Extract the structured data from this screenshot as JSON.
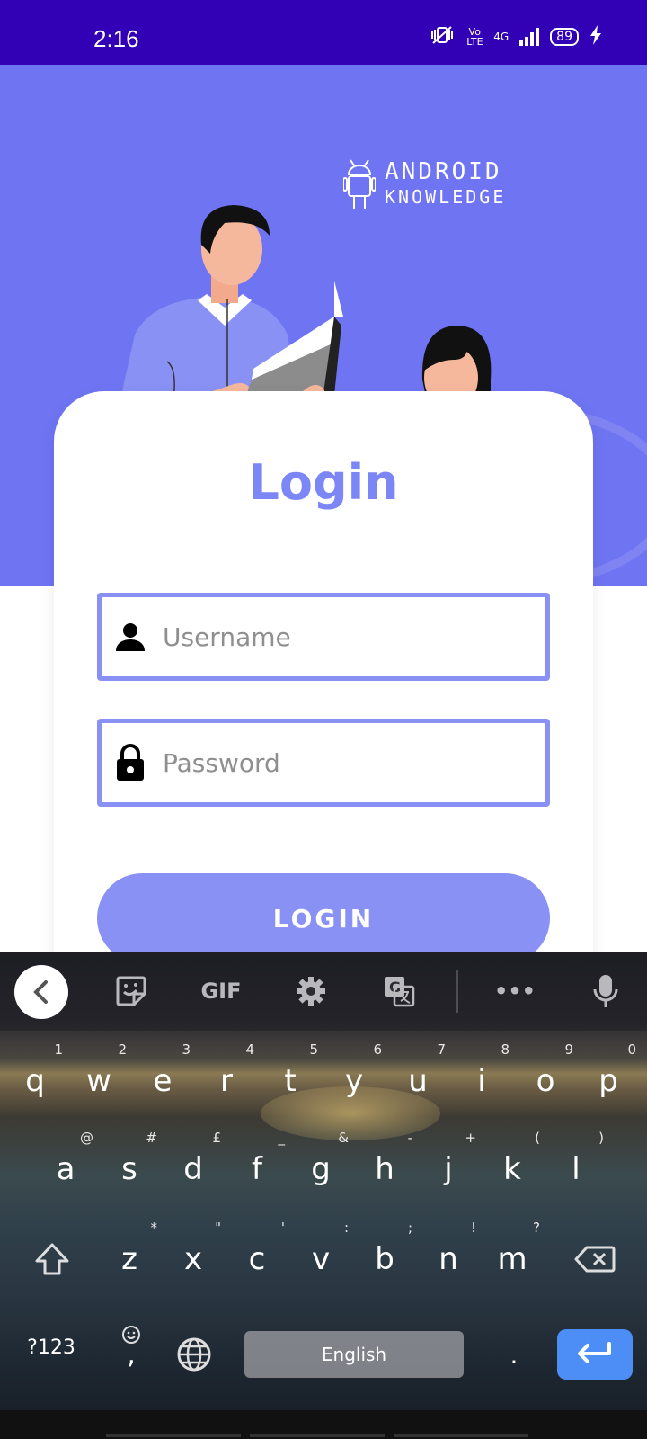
{
  "status_bar": {
    "time": "2:16",
    "network": "4G",
    "volte": "Vo LTE",
    "battery": "89"
  },
  "brand": {
    "line1": "ANDROID",
    "line2": "KNOWLEDGE"
  },
  "login": {
    "title": "Login",
    "username_placeholder": "Username",
    "password_placeholder": "Password",
    "button_label": "LOGIN"
  },
  "keyboard": {
    "toolbar": {
      "gif_label": "GIF",
      "more_label": "•••"
    },
    "row1": [
      {
        "key": "q",
        "hint": "1"
      },
      {
        "key": "w",
        "hint": "2"
      },
      {
        "key": "e",
        "hint": "3"
      },
      {
        "key": "r",
        "hint": "4"
      },
      {
        "key": "t",
        "hint": "5"
      },
      {
        "key": "y",
        "hint": "6"
      },
      {
        "key": "u",
        "hint": "7"
      },
      {
        "key": "i",
        "hint": "8"
      },
      {
        "key": "o",
        "hint": "9"
      },
      {
        "key": "p",
        "hint": "0"
      }
    ],
    "row2": [
      {
        "key": "a",
        "hint": "@"
      },
      {
        "key": "s",
        "hint": "#"
      },
      {
        "key": "d",
        "hint": "£"
      },
      {
        "key": "f",
        "hint": "_"
      },
      {
        "key": "g",
        "hint": "&"
      },
      {
        "key": "h",
        "hint": "-"
      },
      {
        "key": "j",
        "hint": "+"
      },
      {
        "key": "k",
        "hint": "("
      },
      {
        "key": "l",
        "hint": ")"
      }
    ],
    "row3": [
      {
        "key": "z",
        "hint": "*"
      },
      {
        "key": "x",
        "hint": "\""
      },
      {
        "key": "c",
        "hint": "'"
      },
      {
        "key": "v",
        "hint": ":"
      },
      {
        "key": "b",
        "hint": ";"
      },
      {
        "key": "n",
        "hint": "!"
      },
      {
        "key": "m",
        "hint": "?"
      }
    ],
    "symbols_label": "?123",
    "comma_label": ",",
    "space_label": "English",
    "period_label": "."
  },
  "colors": {
    "status_bar": "#3200b5",
    "header": "#6f74f2",
    "accent": "#8a91f5",
    "enter_key": "#4c8df6"
  }
}
